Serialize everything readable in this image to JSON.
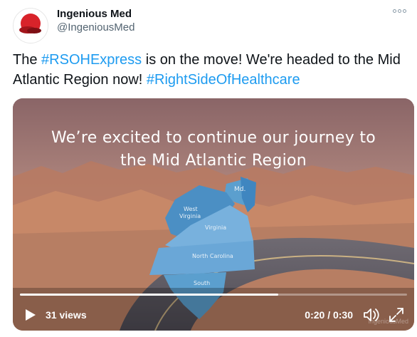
{
  "tweet": {
    "author_name": "Ingenious Med",
    "author_handle": "@IngeniousMed",
    "text_1": "The ",
    "hashtag_1": "#RSOHExpress",
    "text_2": " is on the move! We're headed to the Mid Atlantic Region now! ",
    "hashtag_2": "#RightSideOfHealthcare"
  },
  "media": {
    "title_line_1": "We’re excited to continue our journey to",
    "title_line_2": "the Mid Atlantic Region",
    "states": {
      "maryland": "Md.",
      "west_virginia_1": "West",
      "west_virginia_2": "Virginia",
      "virginia": "Virginia",
      "north_carolina": "North Carolina",
      "south_carolina": "South"
    },
    "watermark": "IngeniousMed",
    "progress": 0.667
  },
  "player": {
    "views": "31 views",
    "time": "0:20 / 0:30",
    "play_icon": "play-icon",
    "volume_icon": "volume-muted-icon",
    "fullscreen_icon": "fullscreen-icon"
  },
  "colors": {
    "link": "#1d9bf0",
    "handle": "#536471",
    "brand_red": "#d8232a"
  }
}
